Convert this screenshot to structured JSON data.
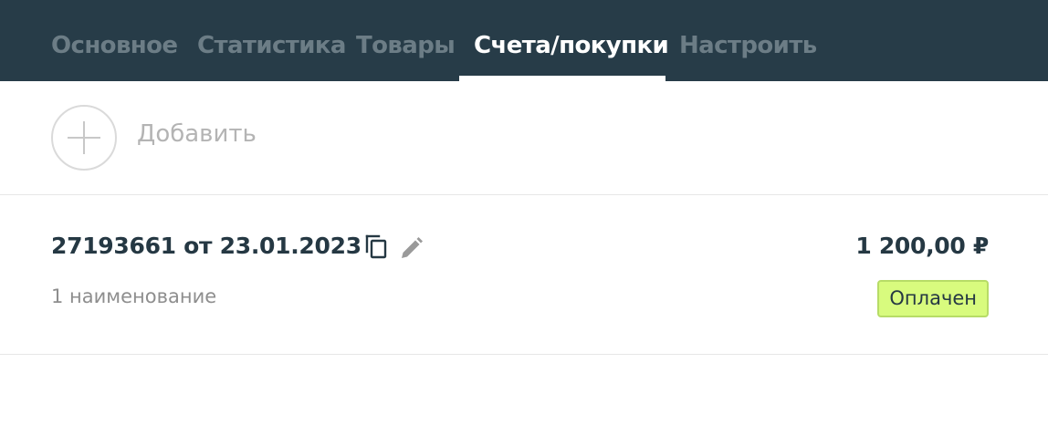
{
  "tabs": [
    {
      "label": "Основное",
      "active": false
    },
    {
      "label": "Статистика",
      "active": false
    },
    {
      "label": "Товары",
      "active": false
    },
    {
      "label": "Счета/покупки",
      "active": true
    },
    {
      "label": "Настроить",
      "active": false
    }
  ],
  "add": {
    "label": "Добавить",
    "icon": "plus-icon"
  },
  "invoice": {
    "title": "27193661 от 23.01.2023",
    "items_count": "1 наименование",
    "amount": "1 200,00 ₽",
    "status": "Оплачен",
    "icons": [
      "copy-icon",
      "edit-icon"
    ]
  },
  "colors": {
    "header_bg": "#273c48",
    "tab_inactive": "#6c7d86",
    "tab_active": "#ffffff",
    "text_dark": "#253843",
    "text_muted": "#8e8e8e",
    "status_bg": "#d8fb7e",
    "status_border": "#b7dc67"
  }
}
